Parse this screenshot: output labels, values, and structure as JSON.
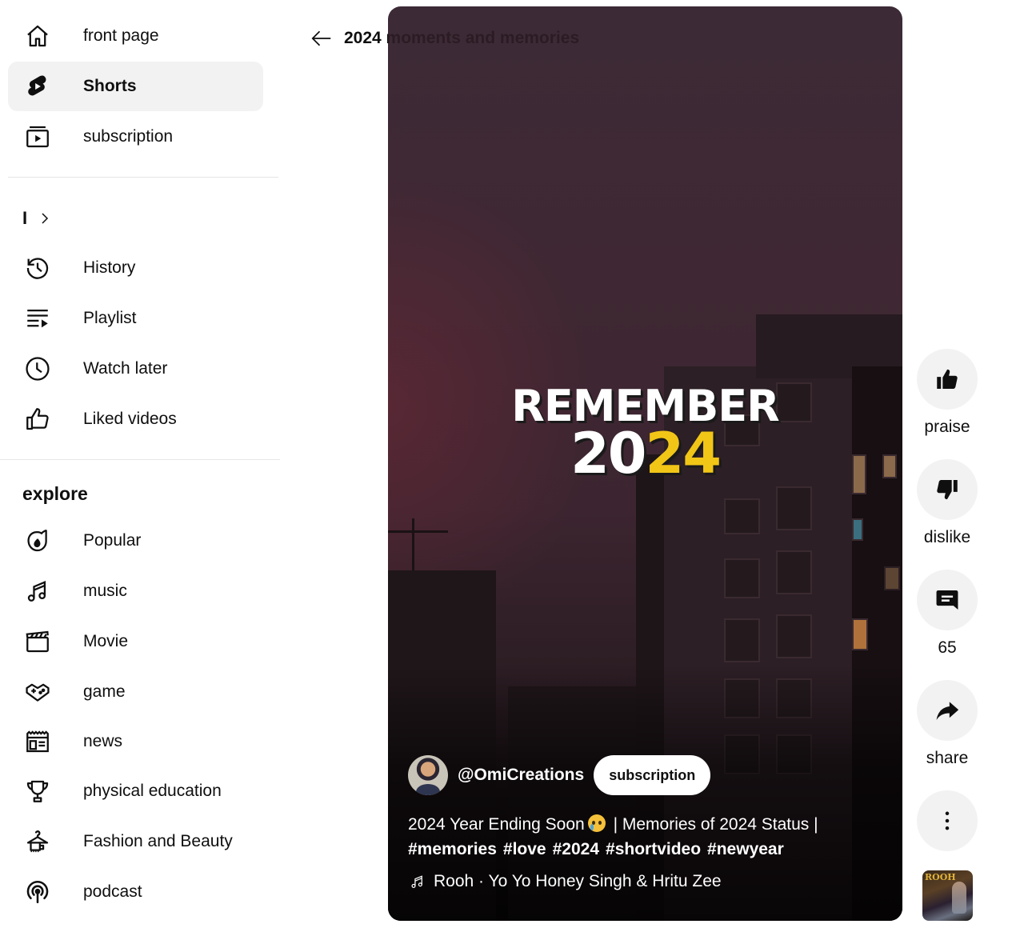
{
  "sidebar": {
    "main_items": [
      {
        "label": "front page",
        "icon": "home-icon",
        "active": false
      },
      {
        "label": "Shorts",
        "icon": "shorts-icon",
        "active": true
      },
      {
        "label": "subscription",
        "icon": "subscriptions-icon",
        "active": false
      }
    ],
    "you_section": {
      "label": "I",
      "chevron": "chevron-right-icon"
    },
    "you_items": [
      {
        "label": "History",
        "icon": "history-icon"
      },
      {
        "label": "Playlist",
        "icon": "playlist-icon"
      },
      {
        "label": "Watch later",
        "icon": "watch-later-icon"
      },
      {
        "label": "Liked videos",
        "icon": "thumbs-up-icon"
      }
    ],
    "explore_title": "explore",
    "explore_items": [
      {
        "label": "Popular",
        "icon": "trending-icon"
      },
      {
        "label": "music",
        "icon": "music-icon"
      },
      {
        "label": "Movie",
        "icon": "clapperboard-icon"
      },
      {
        "label": "game",
        "icon": "gamepad-icon"
      },
      {
        "label": "news",
        "icon": "newspaper-icon"
      },
      {
        "label": "physical education",
        "icon": "trophy-icon"
      },
      {
        "label": "Fashion and Beauty",
        "icon": "hanger-icon"
      },
      {
        "label": "podcast",
        "icon": "podcast-icon"
      }
    ]
  },
  "header": {
    "back_icon": "arrow-left-icon",
    "title": "2024 moments and memories"
  },
  "video": {
    "overlay_line1": "REMEMBER",
    "overlay_line2_white": "20",
    "overlay_line2_yellow": "24",
    "overlay_accent_color": "#f2c617",
    "channel": {
      "handle": "@OmiCreations",
      "subscribe_label": "subscription"
    },
    "caption_text_before_emoji": "2024 Year Ending Soon",
    "caption_emoji": "crying-face-emoji",
    "caption_text_after_emoji": "| Memories of 2024 Status |",
    "hashtags": [
      "#memories",
      "#love",
      "#2024",
      "#shortvideo",
      "#newyear"
    ],
    "music": {
      "icon": "music-note-icon",
      "text": "Rooh · Yo Yo Honey Singh & Hritu Zee"
    }
  },
  "actions": {
    "like_label": "praise",
    "dislike_label": "dislike",
    "comments_count": "65",
    "share_label": "share",
    "more_icon": "more-vertical-icon",
    "sound_thumb_text": "ROOH"
  }
}
